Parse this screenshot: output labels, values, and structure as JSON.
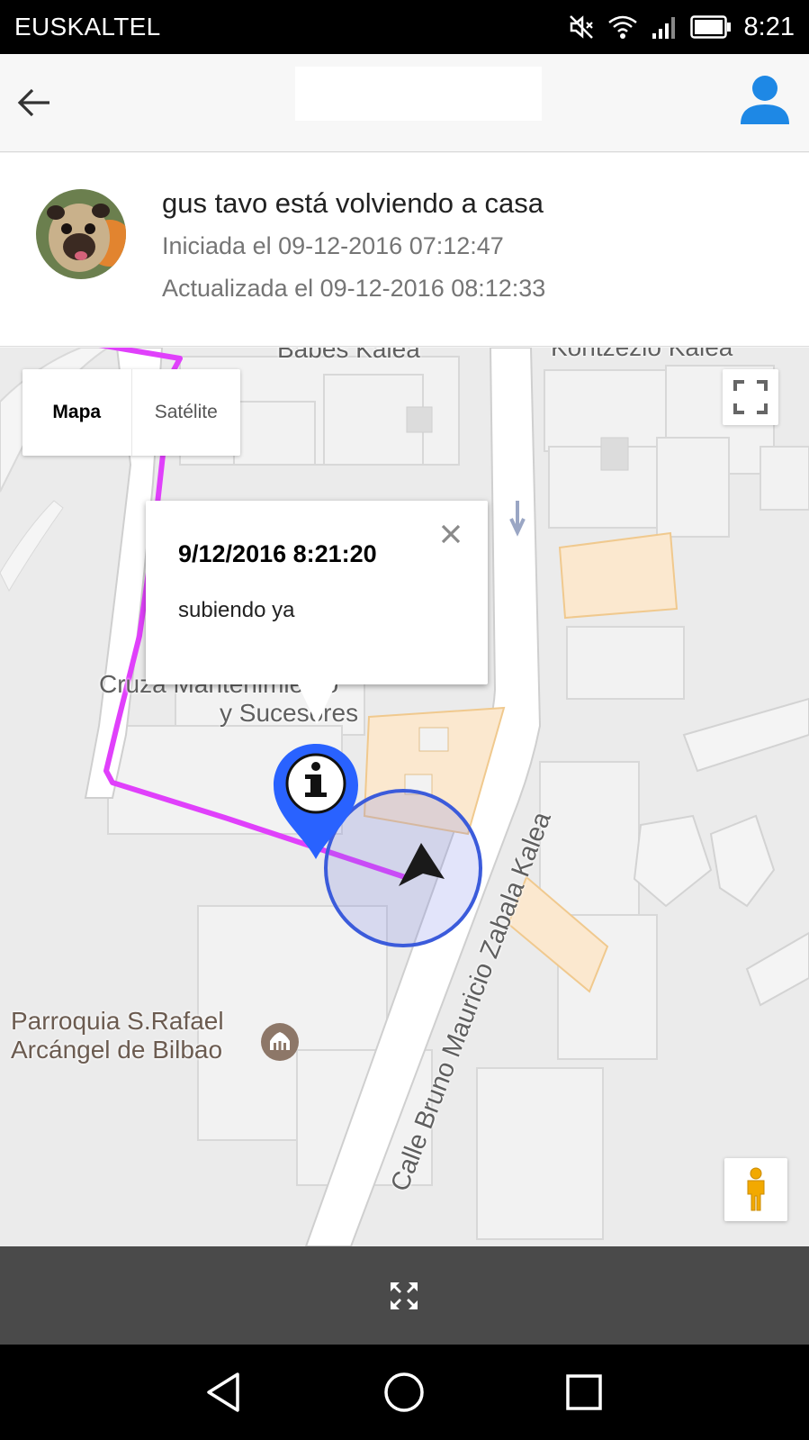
{
  "status_bar": {
    "carrier": "EUSKALTEL",
    "time": "8:21",
    "icons": [
      "mute-icon",
      "wifi-icon",
      "signal-icon",
      "battery-icon"
    ]
  },
  "app_bar": {
    "back_icon": "arrow-back-icon",
    "profile_icon": "person-icon",
    "accent_color": "#1e88e5"
  },
  "trip": {
    "title": "gus tavo  está volviendo a casa",
    "started": "Iniciada el 09-12-2016 07:12:47",
    "updated": "Actualizada el 09-12-2016 08:12:33"
  },
  "map": {
    "type_control": {
      "map_label": "Mapa",
      "satellite_label": "Satélite"
    },
    "popup": {
      "title": "9/12/2016 8:21:20",
      "body": "subiendo ya"
    },
    "labels": {
      "street_top_left": "Babes Kalea",
      "street_top_right": "Kontzezio Kalea",
      "poi_business_line1": "Cruza Mantenimiento",
      "poi_business_line2": "y Sucesores",
      "poi_church_line1": "Parroquia S.Rafael",
      "poi_church_line2": "Arcángel de Bilbao",
      "street_main": "Calle Bruno Mauricio Zabala Kalea"
    },
    "route_color": "#e040fb",
    "marker_color": "#2962ff",
    "accuracy_circle_color": "#3b5bdb"
  },
  "bottom_bar": {
    "expand_icon": "expand-icon"
  },
  "nav_bar": {
    "icons": [
      "back-triangle-icon",
      "home-circle-icon",
      "recents-square-icon"
    ]
  }
}
